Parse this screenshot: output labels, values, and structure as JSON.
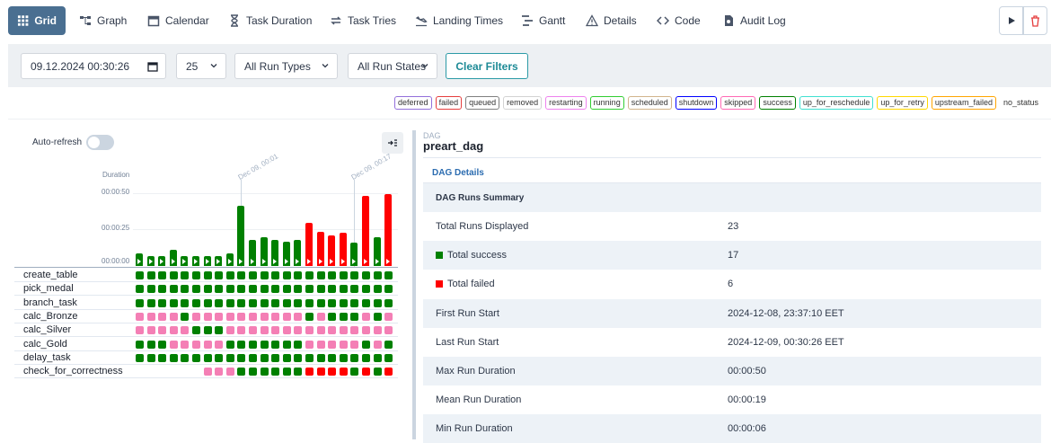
{
  "nav": {
    "tabs": [
      {
        "label": "Grid",
        "icon": "grid-icon",
        "active": true
      },
      {
        "label": "Graph",
        "icon": "graph-icon"
      },
      {
        "label": "Calendar",
        "icon": "calendar-icon"
      },
      {
        "label": "Task Duration",
        "icon": "hourglass-icon"
      },
      {
        "label": "Task Tries",
        "icon": "repeat-icon"
      },
      {
        "label": "Landing Times",
        "icon": "plane-landing-icon"
      },
      {
        "label": "Gantt",
        "icon": "gantt-icon"
      },
      {
        "label": "Details",
        "icon": "warning-triangle-icon"
      },
      {
        "label": "Code",
        "icon": "code-icon"
      },
      {
        "label": "Audit Log",
        "icon": "audit-log-icon"
      }
    ]
  },
  "filters": {
    "datetime": "09.12.2024 00:30:26",
    "num_runs": "25",
    "run_types": "All Run Types",
    "run_states": "All Run States",
    "clear_label": "Clear Filters"
  },
  "legend": [
    {
      "label": "deferred",
      "color": "#9370db"
    },
    {
      "label": "failed",
      "color": "#e53e3e"
    },
    {
      "label": "queued",
      "color": "#808080"
    },
    {
      "label": "removed",
      "color": "#d3d3d3"
    },
    {
      "label": "restarting",
      "color": "#ee82ee"
    },
    {
      "label": "running",
      "color": "#32cd32"
    },
    {
      "label": "scheduled",
      "color": "#d2b48c"
    },
    {
      "label": "shutdown",
      "color": "#0000ff"
    },
    {
      "label": "skipped",
      "color": "#ff69b4"
    },
    {
      "label": "success",
      "color": "#008000"
    },
    {
      "label": "up_for_reschedule",
      "color": "#40e0d0"
    },
    {
      "label": "up_for_retry",
      "color": "#ffd700"
    },
    {
      "label": "upstream_failed",
      "color": "#ffa500"
    },
    {
      "label": "no_status",
      "color": "#ffffff"
    }
  ],
  "grid": {
    "autorefresh_label": "Auto-refresh",
    "duration_label": "Duration",
    "ticks": [
      "00:00:50",
      "00:00:25",
      "00:00:00"
    ],
    "dates": [
      "Dec 09, 00:01",
      "Dec 09, 00:17"
    ],
    "run_durations_s": [
      9,
      7,
      7,
      11,
      7,
      7,
      7,
      7,
      9,
      42,
      18,
      20,
      18,
      17,
      18,
      30,
      24,
      21,
      23,
      16,
      49,
      20,
      50
    ],
    "run_states": [
      "success",
      "success",
      "success",
      "success",
      "success",
      "success",
      "success",
      "success",
      "success",
      "success",
      "success",
      "success",
      "success",
      "success",
      "success",
      "failed",
      "failed",
      "failed",
      "failed",
      "success",
      "failed",
      "success",
      "failed"
    ],
    "colors": {
      "success": "#008000",
      "failed": "#ff0000",
      "skipped": "#f47fb5",
      "none": "transparent"
    },
    "tasks": [
      {
        "name": "create_table",
        "states": "SSSSSSSSSSSSSSSSSSSSSSS"
      },
      {
        "name": "pick_medal",
        "states": "SSSSSSSSSSSSSSSSSSSSSSS"
      },
      {
        "name": "branch_task",
        "states": "SSSSSSSSSSSSSSSSSSSSSSS"
      },
      {
        "name": "calc_Bronze",
        "states": "KKKKSKKKKKKKKKKSKSSSKSK"
      },
      {
        "name": "calc_Silver",
        "states": "KKKKKSSSKKKKKKKKKKKKKKK"
      },
      {
        "name": "calc_Gold",
        "states": "SSSKKKKKSSSSSSSKKKKKSKS"
      },
      {
        "name": "delay_task",
        "states": "SSSSSSSSSSSSSSSSSSSSSSS"
      },
      {
        "name": "check_for_correctness",
        "states": "------KKKSSSSSSFFFFSFSF"
      }
    ]
  },
  "details": {
    "dag_small": "DAG",
    "dag_name": "preart_dag",
    "section": "DAG Details",
    "summary_title": "DAG Runs Summary",
    "rows": [
      {
        "k": "Total Runs Displayed",
        "v": "23"
      },
      {
        "k": "Total success",
        "v": "17",
        "dot": "#008000"
      },
      {
        "k": "Total failed",
        "v": "6",
        "dot": "#ff0000"
      },
      {
        "k": "First Run Start",
        "v": "2024-12-08, 23:37:10 EET"
      },
      {
        "k": "Last Run Start",
        "v": "2024-12-09, 00:30:26 EET"
      },
      {
        "k": "Max Run Duration",
        "v": "00:00:50"
      },
      {
        "k": "Mean Run Duration",
        "v": "00:00:19"
      },
      {
        "k": "Min Run Duration",
        "v": "00:00:06"
      }
    ]
  }
}
